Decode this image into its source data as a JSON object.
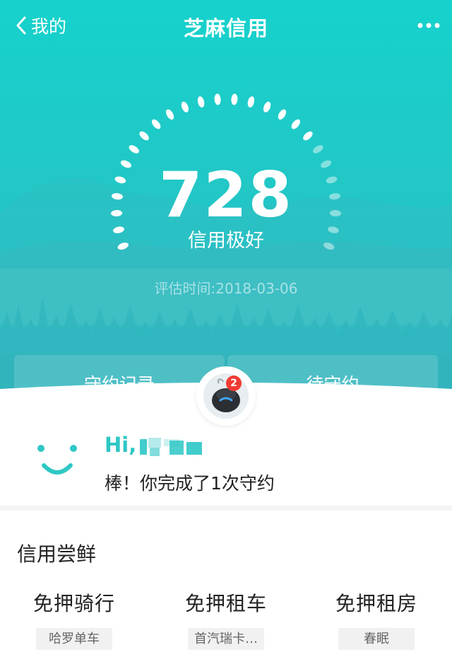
{
  "nav": {
    "back_label": "我的",
    "title": "芝麻信用"
  },
  "score": {
    "value": "728",
    "level": "信用极好",
    "eval_time": "评估时间:2018-03-06",
    "gauge_fraction": 0.72
  },
  "tabs": {
    "left": "守约记录",
    "right": "待守约"
  },
  "avatar": {
    "badge_count": "2"
  },
  "greeting": {
    "hi": "Hi,",
    "message": "棒！你完成了1次守约"
  },
  "section": {
    "title": "信用尝鲜",
    "items": [
      {
        "name": "免押骑行",
        "tag": "哈罗单车"
      },
      {
        "name": "免押租车",
        "tag": "首汽瑞卡…"
      },
      {
        "name": "免押租房",
        "tag": "春眠"
      }
    ]
  },
  "colors": {
    "accent": "#2ec7c5",
    "hero_top": "#16d2cc",
    "badge": "#f23b33"
  }
}
